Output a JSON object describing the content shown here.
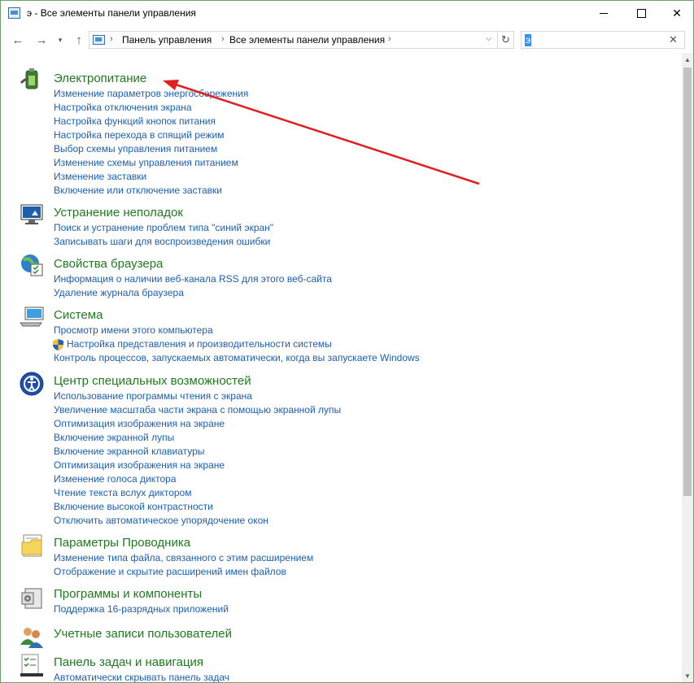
{
  "window": {
    "title": "э - Все элементы панели управления",
    "minimize_label": "",
    "maximize_label": "",
    "close_label": "✕"
  },
  "nav": {
    "back": "←",
    "forward": "→",
    "recent": "▾",
    "up": "↑"
  },
  "address": {
    "breadcrumbs": [
      "Панель управления",
      "Все элементы панели управления"
    ],
    "separator": "›",
    "dropdown": "⌵",
    "refresh": "↻"
  },
  "search": {
    "value": "э",
    "clear": "✕"
  },
  "groups": [
    {
      "title": "Электропитание",
      "icon": "battery-icon",
      "links": [
        "Изменение параметров энергосбережения",
        "Настройка отключения экрана",
        "Настройка функций кнопок питания",
        "Настройка перехода в спящий режим",
        "Выбор схемы управления питанием",
        "Изменение схемы управления питанием",
        "Изменение заставки",
        "Включение или отключение заставки"
      ]
    },
    {
      "title": "Устранение неполадок",
      "icon": "troubleshooting-icon",
      "links": [
        "Поиск и устранение проблем типа \"синий экран\"",
        "Записывать шаги для воспроизведения ошибки"
      ]
    },
    {
      "title": "Свойства браузера",
      "icon": "internet-options-icon",
      "links": [
        "Информация о наличии веб-канала RSS для этого веб-сайта",
        "Удаление журнала браузера"
      ]
    },
    {
      "title": "Система",
      "icon": "system-icon",
      "links": [
        "Просмотр имени этого компьютера",
        "Настройка представления и производительности системы",
        "Контроль процессов, запускаемых автоматически, когда вы запускаете Windows"
      ]
    },
    {
      "title": "Центр специальных возможностей",
      "icon": "accessibility-icon",
      "links": [
        "Использование программы чтения с экрана",
        "Увеличение масштаба части экрана с помощью экранной лупы",
        "Оптимизация изображения на экране",
        "Включение экранной лупы",
        "Включение экранной клавиатуры",
        "Оптимизация изображения на экране",
        "Изменение голоса диктора",
        "Чтение текста вслух диктором",
        "Включение высокой контрастности",
        "Отключить автоматическое упорядочение окон"
      ]
    },
    {
      "title": "Параметры Проводника",
      "icon": "folder-options-icon",
      "links": [
        "Изменение типа файла, связанного с этим расширением",
        "Отображение и скрытие расширений имен файлов"
      ]
    },
    {
      "title": "Программы и компоненты",
      "icon": "programs-icon",
      "links": [
        "Поддержка 16-разрядных приложений"
      ]
    },
    {
      "title": "Учетные записи пользователей",
      "icon": "user-accounts-icon",
      "links": []
    },
    {
      "title": "Панель задач и навигация",
      "icon": "taskbar-icon",
      "links": [
        "Автоматически скрывать панель задач"
      ]
    }
  ],
  "scrollbar": {
    "up": "▲",
    "down": "▼"
  },
  "annotation": {
    "arrow_color": "#e02020"
  }
}
